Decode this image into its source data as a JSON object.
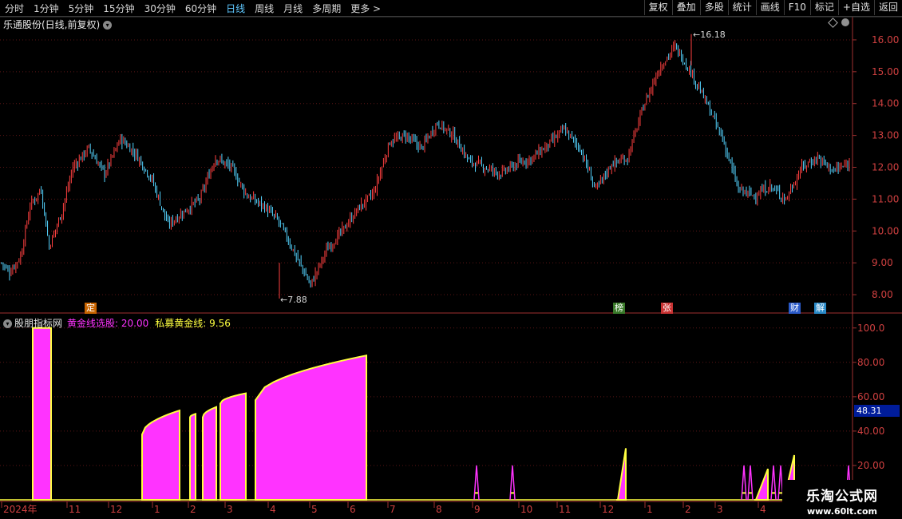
{
  "toolbar": {
    "left_items": [
      "分时",
      "1分钟",
      "5分钟",
      "15分钟",
      "30分钟",
      "60分钟",
      "日线",
      "周线",
      "月线",
      "多周期",
      "更多 >"
    ],
    "active": "日线",
    "right_buttons": [
      "复权",
      "叠加",
      "多股",
      "统计",
      "画线",
      "F10",
      "标记",
      "+自选",
      "返回"
    ]
  },
  "main_chart": {
    "title": "乐通股份(日线,前复权)",
    "y_axis": [
      "16.00",
      "15.00",
      "14.00",
      "13.00",
      "12.00",
      "11.00",
      "10.00",
      "9.00",
      "8.00"
    ],
    "high_label": "16.18",
    "low_label": "7.88",
    "event_tags": [
      {
        "text": "定",
        "color": "#c86400"
      },
      {
        "text": "榜",
        "color": "#3a7a2a"
      },
      {
        "text": "张",
        "color": "#c83232"
      },
      {
        "text": "财",
        "color": "#2a5ac8"
      },
      {
        "text": "解",
        "color": "#2a8ac8"
      }
    ]
  },
  "sub_chart": {
    "name": "股朋指标网",
    "line1_label": "黄金线选股:",
    "line1_value": "20.00",
    "line2_label": "私募黄金线:",
    "line2_value": "9.56",
    "y_axis": [
      "100.0",
      "80.00",
      "60.00",
      "40.00",
      "20.00"
    ],
    "cursor_value": "48.31",
    "colors": {
      "line1": "#ff33ff",
      "line2": "#ffff40"
    }
  },
  "x_axis": {
    "labels": [
      "2024年",
      "11",
      "12",
      "1",
      "2",
      "3",
      "4",
      "5",
      "6",
      "7",
      "8",
      "9",
      "10",
      "11",
      "12",
      "1",
      "2",
      "3",
      "4"
    ]
  },
  "watermark": {
    "line1": "乐淘公式网",
    "line2": "www.60lt.com"
  },
  "chart_data": [
    {
      "type": "candlestick",
      "title": "乐通股份(日线,前复权)",
      "y_range": [
        7.6,
        16.5
      ],
      "annotations": {
        "max": 16.18,
        "min": 7.88
      },
      "price_path": [
        [
          0,
          9.0
        ],
        [
          5,
          8.7
        ],
        [
          12,
          9.2
        ],
        [
          18,
          10.8
        ],
        [
          25,
          11.3
        ],
        [
          30,
          9.5
        ],
        [
          38,
          10.6
        ],
        [
          45,
          12.0
        ],
        [
          55,
          12.6
        ],
        [
          65,
          11.8
        ],
        [
          75,
          12.9
        ],
        [
          85,
          12.4
        ],
        [
          95,
          11.6
        ],
        [
          105,
          10.2
        ],
        [
          115,
          10.6
        ],
        [
          125,
          11.0
        ],
        [
          135,
          12.3
        ],
        [
          145,
          12.0
        ],
        [
          155,
          11.1
        ],
        [
          165,
          10.8
        ],
        [
          175,
          10.3
        ],
        [
          185,
          9.3
        ],
        [
          195,
          8.3
        ],
        [
          205,
          9.4
        ],
        [
          215,
          10.0
        ],
        [
          225,
          10.7
        ],
        [
          235,
          11.2
        ],
        [
          245,
          12.8
        ],
        [
          255,
          13.0
        ],
        [
          265,
          12.6
        ],
        [
          275,
          13.4
        ],
        [
          285,
          13.0
        ],
        [
          295,
          12.2
        ],
        [
          305,
          12.0
        ],
        [
          315,
          11.8
        ],
        [
          325,
          12.1
        ],
        [
          335,
          12.3
        ],
        [
          345,
          12.7
        ],
        [
          355,
          13.2
        ],
        [
          365,
          12.6
        ],
        [
          375,
          11.3
        ],
        [
          385,
          12.1
        ],
        [
          395,
          12.3
        ],
        [
          405,
          13.9
        ],
        [
          415,
          15.1
        ],
        [
          425,
          15.8
        ],
        [
          435,
          15.0
        ],
        [
          445,
          14.0
        ],
        [
          455,
          12.9
        ],
        [
          465,
          11.3
        ],
        [
          475,
          11.1
        ],
        [
          485,
          11.4
        ],
        [
          495,
          11.0
        ],
        [
          505,
          12.0
        ],
        [
          515,
          12.3
        ],
        [
          525,
          11.9
        ],
        [
          535,
          12.1
        ]
      ]
    },
    {
      "type": "area",
      "title": "股朋指标网",
      "y_range": [
        0,
        105
      ],
      "series": [
        {
          "name": "黄金线选股",
          "color": "#ff33ff",
          "last": 20.0
        },
        {
          "name": "私募黄金线",
          "color": "#ffff40",
          "last": 9.56
        }
      ],
      "segments": [
        {
          "x0": 41,
          "x1": 64,
          "v0": 100,
          "v1": 100
        },
        {
          "x0": 178,
          "x1": 225,
          "v0": 38,
          "v1": 52
        },
        {
          "x0": 238,
          "x1": 245,
          "v0": 48,
          "v1": 50
        },
        {
          "x0": 254,
          "x1": 271,
          "v0": 48,
          "v1": 54
        },
        {
          "x0": 276,
          "x1": 308,
          "v0": 56,
          "v1": 62
        },
        {
          "x0": 320,
          "x1": 459,
          "v0": 58,
          "v1": 84
        }
      ],
      "spikes": [
        {
          "x": 597,
          "v": 20
        },
        {
          "x": 642,
          "v": 20
        },
        {
          "x": 932,
          "v": 20
        },
        {
          "x": 940,
          "v": 20
        },
        {
          "x": 969,
          "v": 20
        },
        {
          "x": 978,
          "v": 20
        },
        {
          "x": 1063,
          "v": 20
        }
      ],
      "ramps": [
        {
          "x0": 772,
          "x1": 784,
          "v0": 0,
          "v1": 30
        },
        {
          "x0": 945,
          "x1": 962,
          "v0": 0,
          "v1": 18
        },
        {
          "x0": 985,
          "x1": 995,
          "v0": 10,
          "v1": 26
        }
      ]
    }
  ]
}
